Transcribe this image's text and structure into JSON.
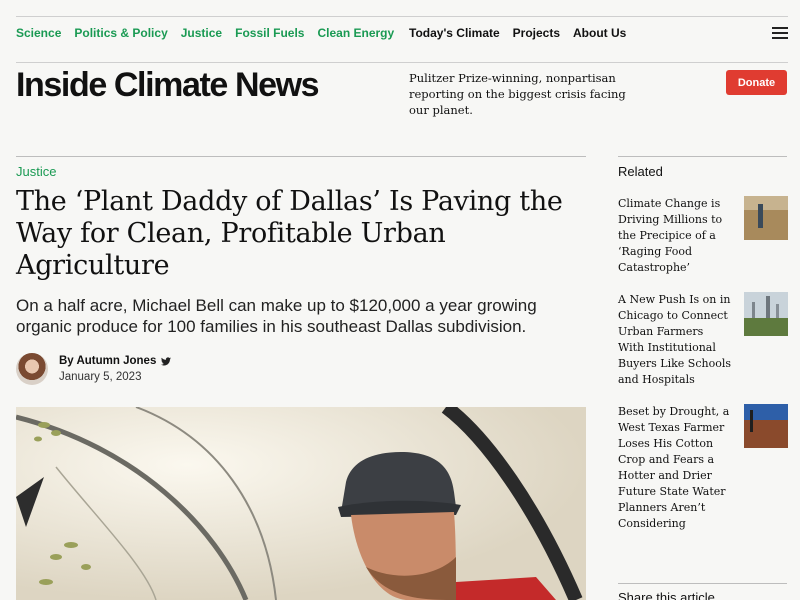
{
  "section_nav": [
    "Science",
    "Politics & Policy",
    "Justice",
    "Fossil Fuels",
    "Clean Energy"
  ],
  "main_nav": [
    "Today's Climate",
    "Projects",
    "About Us"
  ],
  "icons": {
    "menu": "hamburger-menu-icon",
    "twitter": "twitter-icon"
  },
  "brand": {
    "logo": "Inside Climate News",
    "tagline": "Pulitzer Prize-winning, nonpartisan reporting on the biggest crisis facing our planet.",
    "donate_label": "Donate"
  },
  "colors": {
    "accent_green": "#1a9a53",
    "donate_red": "#e03c31"
  },
  "article": {
    "category": "Justice",
    "headline": "The ‘Plant Daddy of Dallas’ Is Paving the Way for Clean, Profitable Urban Agriculture",
    "dek": "On a half acre, Michael Bell can make up to $120,000 a year growing organic produce for 100 families in his southeast Dallas subdivision.",
    "author": "By Autumn Jones",
    "date": "January 5, 2023"
  },
  "sidebar": {
    "related_heading": "Related",
    "related": [
      {
        "title": "Climate Change is Driving Millions to the Precipice of a ‘Raging Food Catastrophe’"
      },
      {
        "title": "A New Push Is on in Chicago to Connect Urban Farmers With Institutional Buyers Like Schools and Hospitals"
      },
      {
        "title": "Beset by Drought, a West Texas Farmer Loses His Cotton Crop and Fears a Hotter and Drier Future State Water Planners Aren’t Considering"
      }
    ],
    "share_heading": "Share this article"
  }
}
